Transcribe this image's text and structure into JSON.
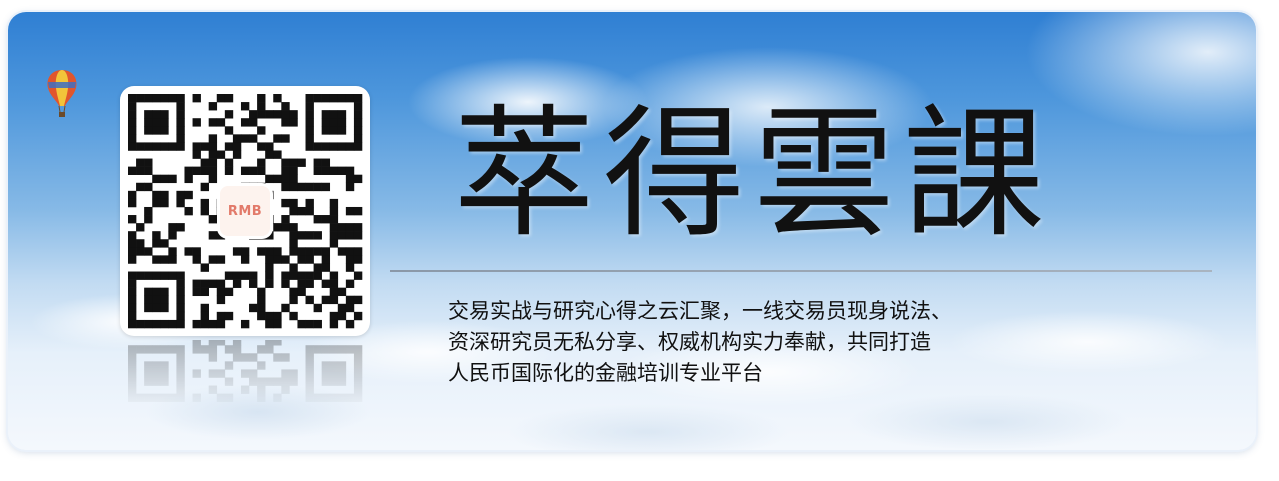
{
  "banner": {
    "title": "萃得雲課",
    "description_lines": [
      "交易实战与研究心得之云汇聚，一线交易员现身说法、",
      "资深研究员无私分享、权威机构实力奉献，共同打造",
      "人民币国际化的金融培训专业平台"
    ],
    "qr_logo_text": "RMB"
  },
  "icons": {
    "balloon": "hot-air-balloon-icon",
    "qr": "qr-code"
  },
  "colors": {
    "sky_top": "#2f7fd3",
    "sky_bottom": "#f4f8fd",
    "title_ink": "#111111",
    "logo_accent": "#e27a6a"
  }
}
